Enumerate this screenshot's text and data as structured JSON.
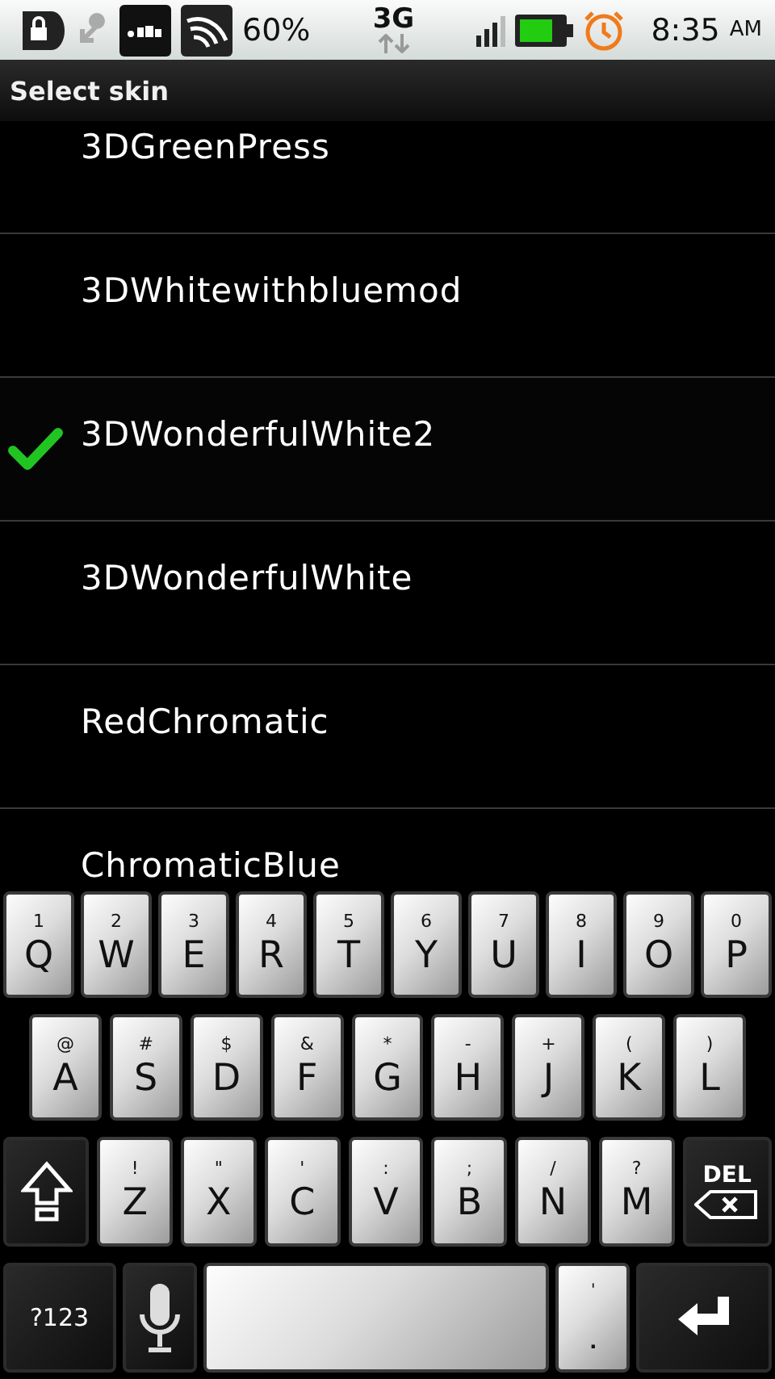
{
  "status_bar": {
    "battery_text": "60%",
    "network": "3G",
    "time": "8:35",
    "am_pm": "AM"
  },
  "title": "Select skin",
  "skins": [
    {
      "label": "3DGreenPress",
      "selected": false
    },
    {
      "label": "3DWhitewithbluemod",
      "selected": false
    },
    {
      "label": "3DWonderfulWhite2",
      "selected": true
    },
    {
      "label": "3DWonderfulWhite",
      "selected": false
    },
    {
      "label": "RedChromatic",
      "selected": false
    },
    {
      "label": "ChromaticBlue",
      "selected": false
    }
  ],
  "keyboard": {
    "rows": [
      {
        "keys": [
          {
            "kind": "letter",
            "label": "Q",
            "hint": "1"
          },
          {
            "kind": "letter",
            "label": "W",
            "hint": "2"
          },
          {
            "kind": "letter",
            "label": "E",
            "hint": "3"
          },
          {
            "kind": "letter",
            "label": "R",
            "hint": "4"
          },
          {
            "kind": "letter",
            "label": "T",
            "hint": "5"
          },
          {
            "kind": "letter",
            "label": "Y",
            "hint": "6"
          },
          {
            "kind": "letter",
            "label": "U",
            "hint": "7"
          },
          {
            "kind": "letter",
            "label": "I",
            "hint": "8"
          },
          {
            "kind": "letter",
            "label": "O",
            "hint": "9"
          },
          {
            "kind": "letter",
            "label": "P",
            "hint": "0"
          }
        ]
      },
      {
        "keys": [
          {
            "kind": "letter",
            "label": "A",
            "hint": "@"
          },
          {
            "kind": "letter",
            "label": "S",
            "hint": "#"
          },
          {
            "kind": "letter",
            "label": "D",
            "hint": "$"
          },
          {
            "kind": "letter",
            "label": "F",
            "hint": "&"
          },
          {
            "kind": "letter",
            "label": "G",
            "hint": "*"
          },
          {
            "kind": "letter",
            "label": "H",
            "hint": "-"
          },
          {
            "kind": "letter",
            "label": "J",
            "hint": "+"
          },
          {
            "kind": "letter",
            "label": "K",
            "hint": "("
          },
          {
            "kind": "letter",
            "label": "L",
            "hint": ")"
          }
        ]
      },
      {
        "keys": [
          {
            "kind": "shift"
          },
          {
            "kind": "letter",
            "label": "Z",
            "hint": "!"
          },
          {
            "kind": "letter",
            "label": "X",
            "hint": "\""
          },
          {
            "kind": "letter",
            "label": "C",
            "hint": "'"
          },
          {
            "kind": "letter",
            "label": "V",
            "hint": ":"
          },
          {
            "kind": "letter",
            "label": "B",
            "hint": ";"
          },
          {
            "kind": "letter",
            "label": "N",
            "hint": "/"
          },
          {
            "kind": "letter",
            "label": "M",
            "hint": "?"
          },
          {
            "kind": "delete",
            "label": "DEL"
          }
        ]
      },
      {
        "keys": [
          {
            "kind": "symbols",
            "label": "?123"
          },
          {
            "kind": "mic"
          },
          {
            "kind": "space"
          },
          {
            "kind": "punct",
            "hint": "'",
            "label": "."
          },
          {
            "kind": "enter"
          }
        ]
      }
    ]
  }
}
